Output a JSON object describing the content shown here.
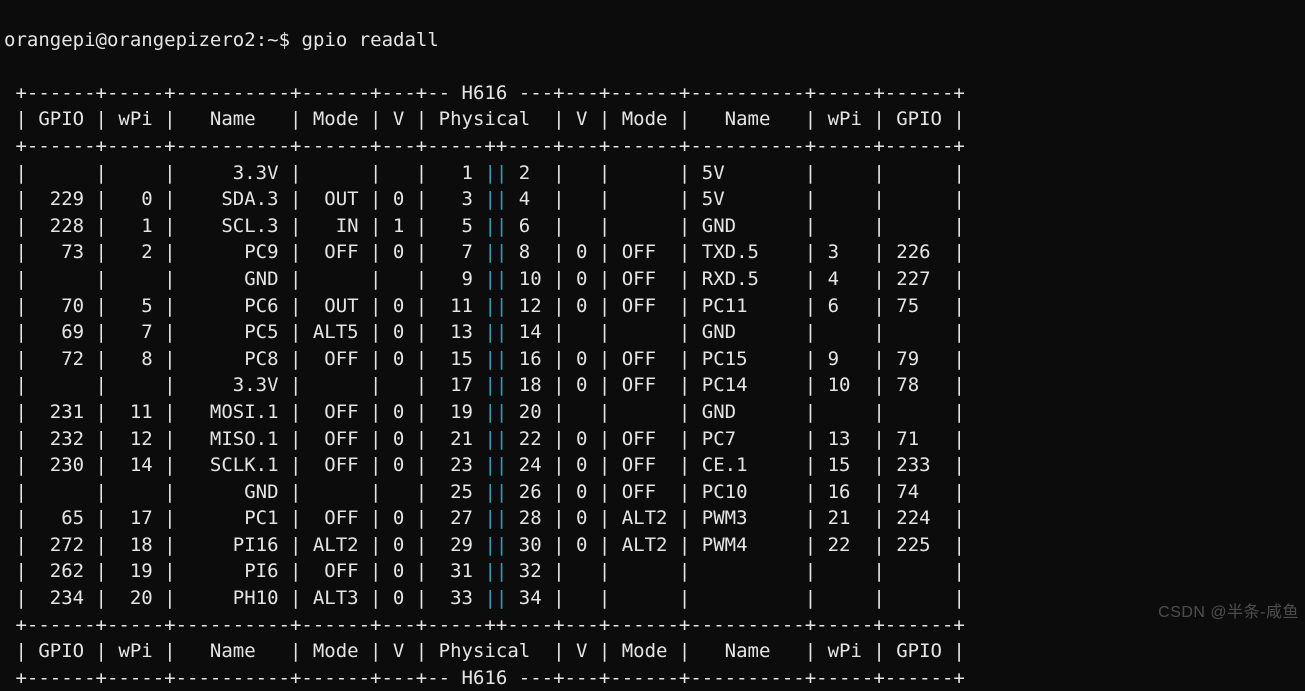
{
  "prompt": {
    "user": "orangepi",
    "host": "orangepizero2",
    "path": "~",
    "symbol": "$",
    "command": "gpio readall"
  },
  "chip": "H616",
  "headers": [
    "GPIO",
    "wPi",
    "Name",
    "Mode",
    "V",
    "Physical",
    "V",
    "Mode",
    "Name",
    "wPi",
    "GPIO"
  ],
  "rows": [
    {
      "l": {
        "gpio": "",
        "wpi": "",
        "name": "3.3V",
        "mode": "",
        "v": ""
      },
      "phys": [
        "1",
        "2"
      ],
      "r": {
        "v": "",
        "mode": "",
        "name": "5V",
        "wpi": "",
        "gpio": ""
      }
    },
    {
      "l": {
        "gpio": "229",
        "wpi": "0",
        "name": "SDA.3",
        "mode": "OUT",
        "v": "0"
      },
      "phys": [
        "3",
        "4"
      ],
      "r": {
        "v": "",
        "mode": "",
        "name": "5V",
        "wpi": "",
        "gpio": ""
      }
    },
    {
      "l": {
        "gpio": "228",
        "wpi": "1",
        "name": "SCL.3",
        "mode": "IN",
        "v": "1"
      },
      "phys": [
        "5",
        "6"
      ],
      "r": {
        "v": "",
        "mode": "",
        "name": "GND",
        "wpi": "",
        "gpio": ""
      }
    },
    {
      "l": {
        "gpio": "73",
        "wpi": "2",
        "name": "PC9",
        "mode": "OFF",
        "v": "0"
      },
      "phys": [
        "7",
        "8"
      ],
      "r": {
        "v": "0",
        "mode": "OFF",
        "name": "TXD.5",
        "wpi": "3",
        "gpio": "226"
      }
    },
    {
      "l": {
        "gpio": "",
        "wpi": "",
        "name": "GND",
        "mode": "",
        "v": ""
      },
      "phys": [
        "9",
        "10"
      ],
      "r": {
        "v": "0",
        "mode": "OFF",
        "name": "RXD.5",
        "wpi": "4",
        "gpio": "227"
      }
    },
    {
      "l": {
        "gpio": "70",
        "wpi": "5",
        "name": "PC6",
        "mode": "OUT",
        "v": "0"
      },
      "phys": [
        "11",
        "12"
      ],
      "r": {
        "v": "0",
        "mode": "OFF",
        "name": "PC11",
        "wpi": "6",
        "gpio": "75"
      }
    },
    {
      "l": {
        "gpio": "69",
        "wpi": "7",
        "name": "PC5",
        "mode": "ALT5",
        "v": "0"
      },
      "phys": [
        "13",
        "14"
      ],
      "r": {
        "v": "",
        "mode": "",
        "name": "GND",
        "wpi": "",
        "gpio": ""
      }
    },
    {
      "l": {
        "gpio": "72",
        "wpi": "8",
        "name": "PC8",
        "mode": "OFF",
        "v": "0"
      },
      "phys": [
        "15",
        "16"
      ],
      "r": {
        "v": "0",
        "mode": "OFF",
        "name": "PC15",
        "wpi": "9",
        "gpio": "79"
      }
    },
    {
      "l": {
        "gpio": "",
        "wpi": "",
        "name": "3.3V",
        "mode": "",
        "v": ""
      },
      "phys": [
        "17",
        "18"
      ],
      "r": {
        "v": "0",
        "mode": "OFF",
        "name": "PC14",
        "wpi": "10",
        "gpio": "78"
      }
    },
    {
      "l": {
        "gpio": "231",
        "wpi": "11",
        "name": "MOSI.1",
        "mode": "OFF",
        "v": "0"
      },
      "phys": [
        "19",
        "20"
      ],
      "r": {
        "v": "",
        "mode": "",
        "name": "GND",
        "wpi": "",
        "gpio": ""
      }
    },
    {
      "l": {
        "gpio": "232",
        "wpi": "12",
        "name": "MISO.1",
        "mode": "OFF",
        "v": "0"
      },
      "phys": [
        "21",
        "22"
      ],
      "r": {
        "v": "0",
        "mode": "OFF",
        "name": "PC7",
        "wpi": "13",
        "gpio": "71"
      }
    },
    {
      "l": {
        "gpio": "230",
        "wpi": "14",
        "name": "SCLK.1",
        "mode": "OFF",
        "v": "0"
      },
      "phys": [
        "23",
        "24"
      ],
      "r": {
        "v": "0",
        "mode": "OFF",
        "name": "CE.1",
        "wpi": "15",
        "gpio": "233"
      }
    },
    {
      "l": {
        "gpio": "",
        "wpi": "",
        "name": "GND",
        "mode": "",
        "v": ""
      },
      "phys": [
        "25",
        "26"
      ],
      "r": {
        "v": "0",
        "mode": "OFF",
        "name": "PC10",
        "wpi": "16",
        "gpio": "74"
      }
    },
    {
      "l": {
        "gpio": "65",
        "wpi": "17",
        "name": "PC1",
        "mode": "OFF",
        "v": "0"
      },
      "phys": [
        "27",
        "28"
      ],
      "r": {
        "v": "0",
        "mode": "ALT2",
        "name": "PWM3",
        "wpi": "21",
        "gpio": "224"
      }
    },
    {
      "l": {
        "gpio": "272",
        "wpi": "18",
        "name": "PI16",
        "mode": "ALT2",
        "v": "0"
      },
      "phys": [
        "29",
        "30"
      ],
      "r": {
        "v": "0",
        "mode": "ALT2",
        "name": "PWM4",
        "wpi": "22",
        "gpio": "225"
      }
    },
    {
      "l": {
        "gpio": "262",
        "wpi": "19",
        "name": "PI6",
        "mode": "OFF",
        "v": "0"
      },
      "phys": [
        "31",
        "32"
      ],
      "r": {
        "v": "",
        "mode": "",
        "name": "",
        "wpi": "",
        "gpio": ""
      }
    },
    {
      "l": {
        "gpio": "234",
        "wpi": "20",
        "name": "PH10",
        "mode": "ALT3",
        "v": "0"
      },
      "phys": [
        "33",
        "34"
      ],
      "r": {
        "v": "",
        "mode": "",
        "name": "",
        "wpi": "",
        "gpio": ""
      }
    }
  ],
  "watermark": "CSDN @半条-咸鱼"
}
